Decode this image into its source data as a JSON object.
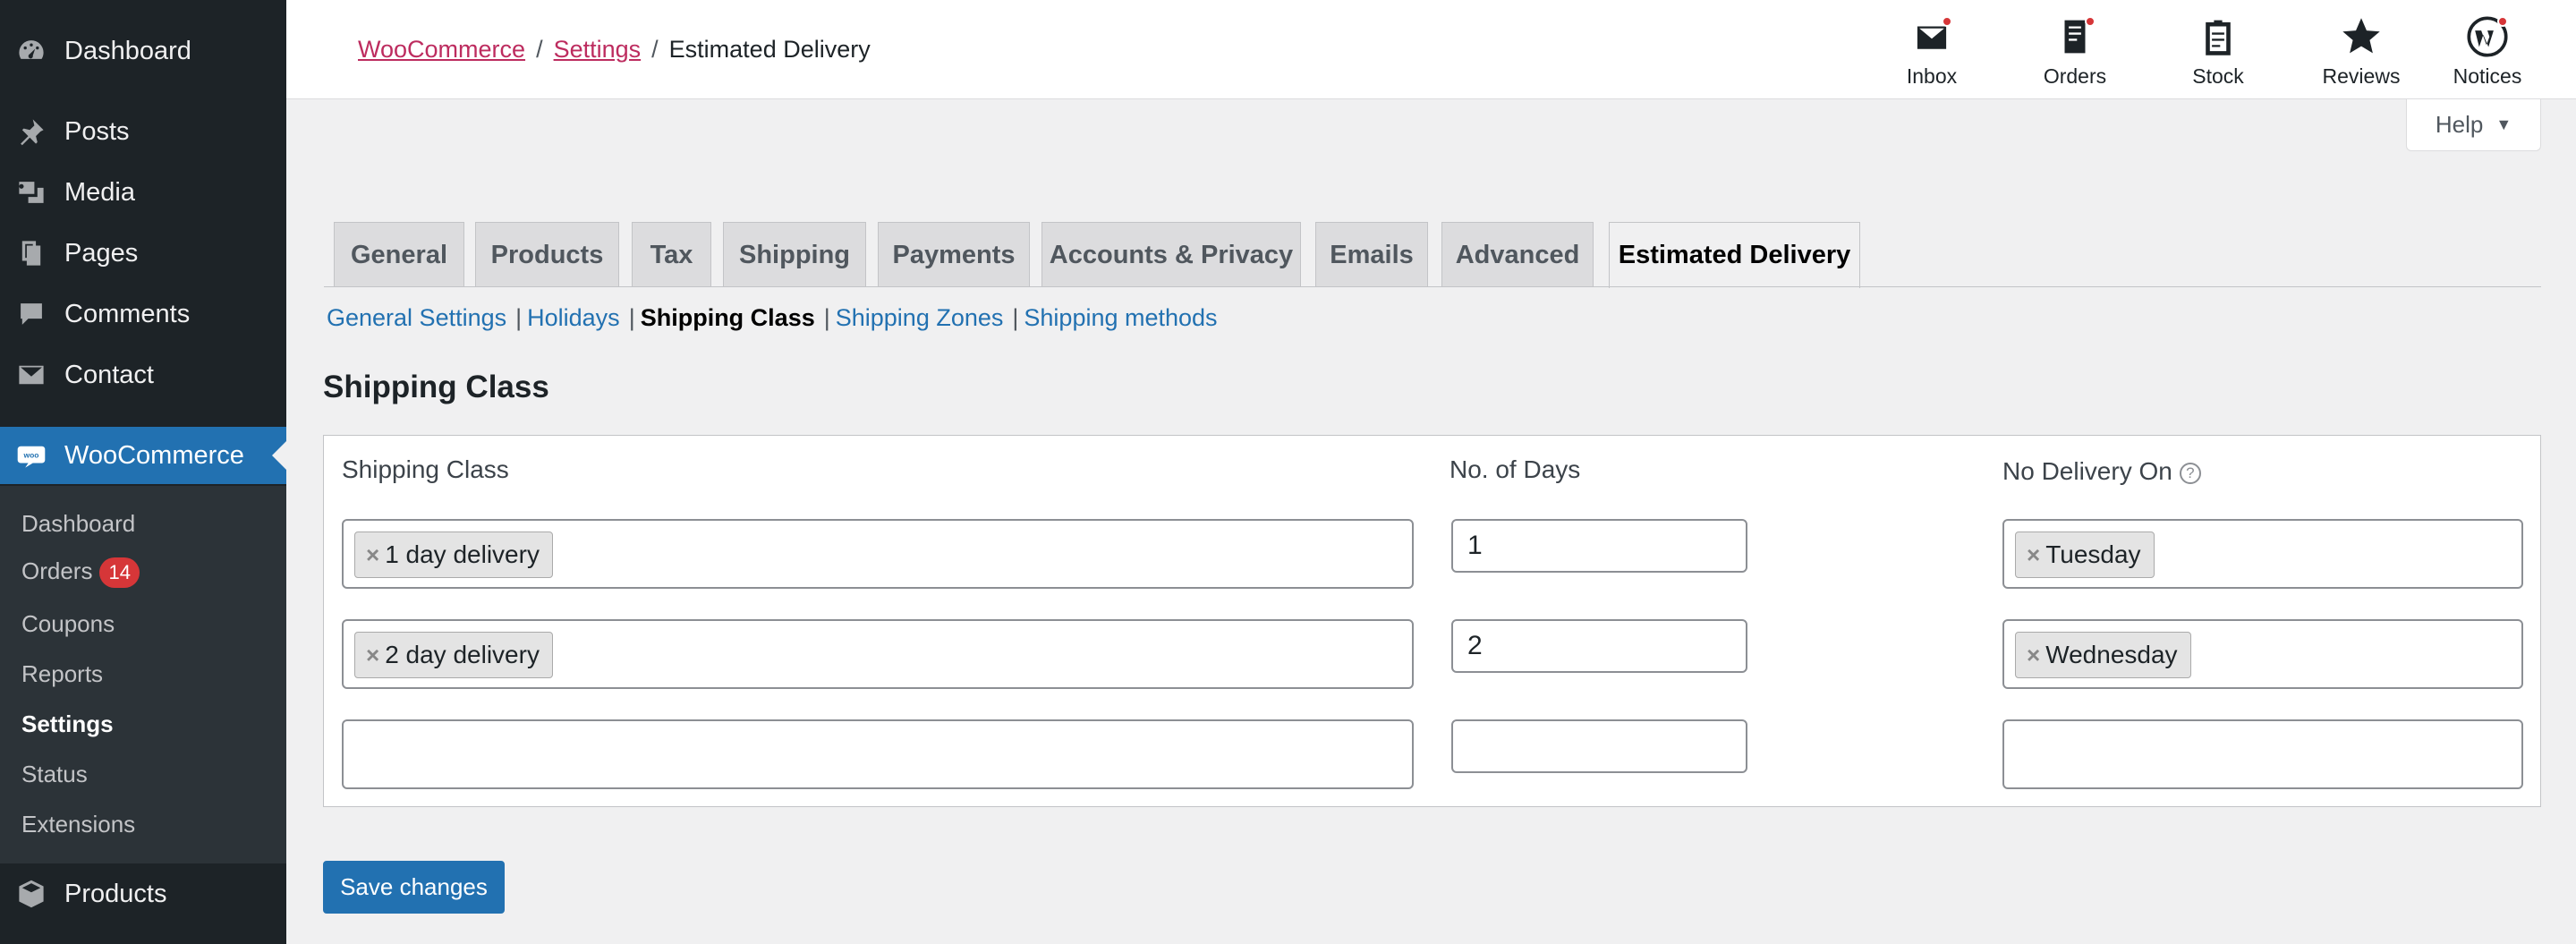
{
  "sidebar": {
    "items": [
      {
        "label": "Dashboard",
        "icon": "dashboard-icon"
      },
      {
        "label": "Posts",
        "icon": "pin-icon"
      },
      {
        "label": "Media",
        "icon": "media-icon"
      },
      {
        "label": "Pages",
        "icon": "pages-icon"
      },
      {
        "label": "Comments",
        "icon": "comment-icon"
      },
      {
        "label": "Contact",
        "icon": "mail-icon"
      },
      {
        "label": "WooCommerce",
        "icon": "woo-icon"
      }
    ],
    "submenu": [
      {
        "label": "Dashboard"
      },
      {
        "label": "Orders",
        "badge": "14"
      },
      {
        "label": "Coupons"
      },
      {
        "label": "Reports"
      },
      {
        "label": "Settings"
      },
      {
        "label": "Status"
      },
      {
        "label": "Extensions"
      }
    ],
    "bottom_item": {
      "label": "Products",
      "icon": "box-icon"
    }
  },
  "breadcrumb": {
    "items": [
      "WooCommerce",
      "Settings"
    ],
    "current": "Estimated Delivery",
    "separator": "/"
  },
  "topbar": {
    "icons": [
      {
        "label": "Inbox",
        "icon": "inbox-icon",
        "notify": true
      },
      {
        "label": "Orders",
        "icon": "orders-icon",
        "notify": true
      },
      {
        "label": "Stock",
        "icon": "stock-icon",
        "notify": false
      },
      {
        "label": "Reviews",
        "icon": "star-icon",
        "notify": false
      },
      {
        "label": "Notices",
        "icon": "wordpress-icon",
        "notify": true
      }
    ]
  },
  "help": {
    "label": "Help",
    "caret": "▼"
  },
  "tabs": [
    "General",
    "Products",
    "Tax",
    "Shipping",
    "Payments",
    "Accounts & Privacy",
    "Emails",
    "Advanced",
    "Estimated Delivery"
  ],
  "active_tab": "Estimated Delivery",
  "sublinks": [
    "General Settings",
    "Holidays",
    "Shipping Class",
    "Shipping Zones",
    "Shipping methods"
  ],
  "sublinks_separator": "|",
  "current_sublink": "Shipping Class",
  "section_title": "Shipping Class",
  "table": {
    "headers": [
      "Shipping Class",
      "No. of Days",
      "No Delivery On"
    ],
    "help_glyph": "?",
    "remove_glyph": "×",
    "rows": [
      {
        "shipping_class": "1 day delivery",
        "days": "1",
        "no_delivery": "Tuesday"
      },
      {
        "shipping_class": "2 day delivery",
        "days": "2",
        "no_delivery": "Wednesday"
      },
      {
        "shipping_class": "",
        "days": "",
        "no_delivery": ""
      }
    ]
  },
  "save_label": "Save changes",
  "colors": {
    "accent": "#2271b1",
    "sidebar": "#1d2327",
    "link": "#bd2c5f",
    "badge": "#d63638"
  }
}
